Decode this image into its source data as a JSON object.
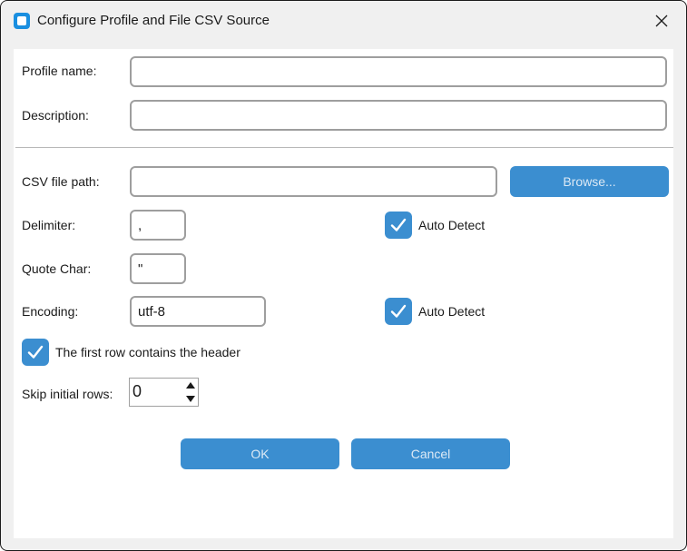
{
  "window": {
    "title": "Configure Profile and File CSV Source"
  },
  "profile": {
    "name_label": "Profile name:",
    "name_value": "",
    "description_label": "Description:",
    "description_value": ""
  },
  "csv": {
    "path_label": "CSV file path:",
    "path_value": "",
    "browse_label": "Browse...",
    "delimiter_label": "Delimiter:",
    "delimiter_value": ",",
    "delimiter_auto_label": "Auto Detect",
    "delimiter_auto_checked": true,
    "quote_label": "Quote Char:",
    "quote_value": "\"",
    "encoding_label": "Encoding:",
    "encoding_value": "utf-8",
    "encoding_auto_label": "Auto Detect",
    "encoding_auto_checked": true,
    "header_label": "The first row contains the header",
    "header_checked": true,
    "skip_label": "Skip initial rows:",
    "skip_value": "0"
  },
  "actions": {
    "ok_label": "OK",
    "cancel_label": "Cancel"
  },
  "colors": {
    "accent": "#3b8ed0",
    "app_icon": "#1a8fe0"
  },
  "icons": {
    "app": "app-icon",
    "close": "close-icon",
    "check": "checkmark-icon"
  }
}
